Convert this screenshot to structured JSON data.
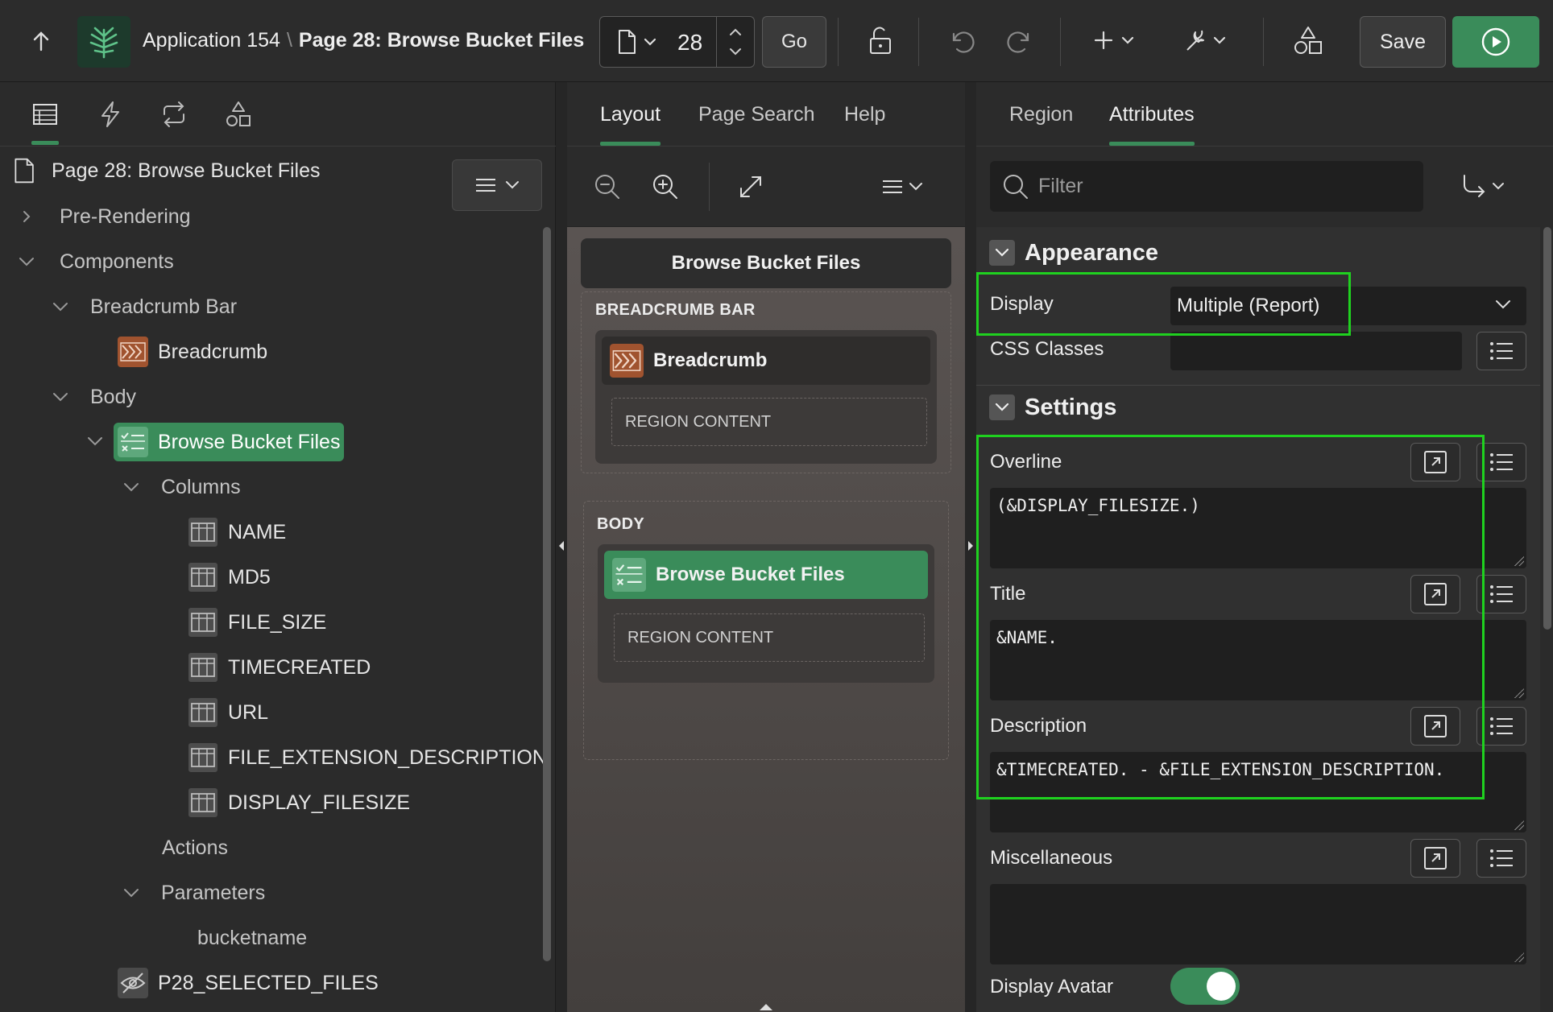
{
  "header": {
    "app_name": "Application 154",
    "separator": "\\",
    "page_name": "Page 28: Browse Bucket Files",
    "page_number": "28",
    "go_label": "Go",
    "save_label": "Save"
  },
  "left_panel": {
    "page_title": "Page 28: Browse Bucket Files",
    "tree": {
      "pre_rendering": "Pre-Rendering",
      "components": "Components",
      "breadcrumb_bar": "Breadcrumb Bar",
      "breadcrumb": "Breadcrumb",
      "body": "Body",
      "region": "Browse Bucket Files",
      "columns_label": "Columns",
      "columns": [
        "NAME",
        "MD5",
        "FILE_SIZE",
        "TIMECREATED",
        "URL",
        "FILE_EXTENSION_DESCRIPTION",
        "DISPLAY_FILESIZE"
      ],
      "actions": "Actions",
      "parameters": "Parameters",
      "param_bucketname": "bucketname",
      "hidden_item": "P28_SELECTED_FILES"
    }
  },
  "middle_panel": {
    "tabs": [
      "Layout",
      "Page Search",
      "Help"
    ],
    "page_header": "Browse Bucket Files",
    "breadcrumb_bar_label": "BREADCRUMB BAR",
    "breadcrumb_component": "Breadcrumb",
    "region_content": "REGION CONTENT",
    "body_label": "BODY",
    "body_component": "Browse Bucket Files"
  },
  "right_panel": {
    "tabs": [
      "Region",
      "Attributes"
    ],
    "filter_placeholder": "Filter",
    "appearance": {
      "title": "Appearance",
      "display_label": "Display",
      "display_value": "Multiple (Report)",
      "css_label": "CSS Classes",
      "css_value": ""
    },
    "settings": {
      "title": "Settings",
      "overline_label": "Overline",
      "overline_value": "(&DISPLAY_FILESIZE.)",
      "title_label": "Title",
      "title_value": "&NAME.",
      "description_label": "Description",
      "description_value": "&TIMECREATED. - &FILE_EXTENSION_DESCRIPTION.",
      "misc_label": "Miscellaneous",
      "misc_value": "",
      "avatar_label": "Display Avatar",
      "avatar_on": true
    }
  },
  "colors": {
    "accent_green": "#3a8c5a",
    "highlight": "#1fd11f",
    "component_orange": "#a0532f"
  }
}
